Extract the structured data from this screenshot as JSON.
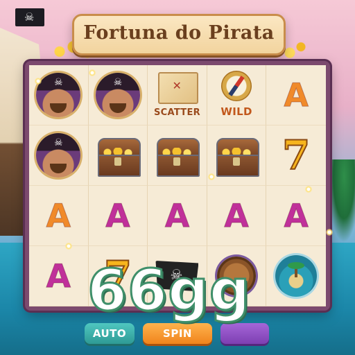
{
  "game": {
    "title": "Fortuna do Pirata",
    "watermark": "66gg"
  },
  "symbols": {
    "scatter_label": "SCATTER",
    "wild_label": "WILD"
  },
  "reels": [
    [
      "pirate-icon",
      "pirate-icon",
      "scatter",
      "wild",
      "A"
    ],
    [
      "pirate-icon",
      "chest-icon",
      "chest-icon",
      "chest-icon",
      "7"
    ],
    [
      "A",
      "A",
      "A",
      "A",
      "A"
    ],
    [
      "A",
      "7",
      "pirate-flag-icon",
      "barrel-icon",
      "island-icon"
    ]
  ],
  "letters": {
    "r0c4": "A",
    "r1c4": "7",
    "r2c0": "A",
    "r2c1": "A",
    "r2c2": "A",
    "r2c3": "A",
    "r2c4": "A",
    "r3c0": "A",
    "r3c1": "7"
  },
  "controls": {
    "auto_label": "AUTO",
    "spin_label": "SPIN",
    "other_label": ""
  },
  "colors": {
    "letter_orange": "#f08a2a",
    "letter_magenta": "#c0309a",
    "seven_gold": "#f7b51e",
    "scatter_text": "#9a4a1c",
    "wild_text": "#c2581c"
  }
}
